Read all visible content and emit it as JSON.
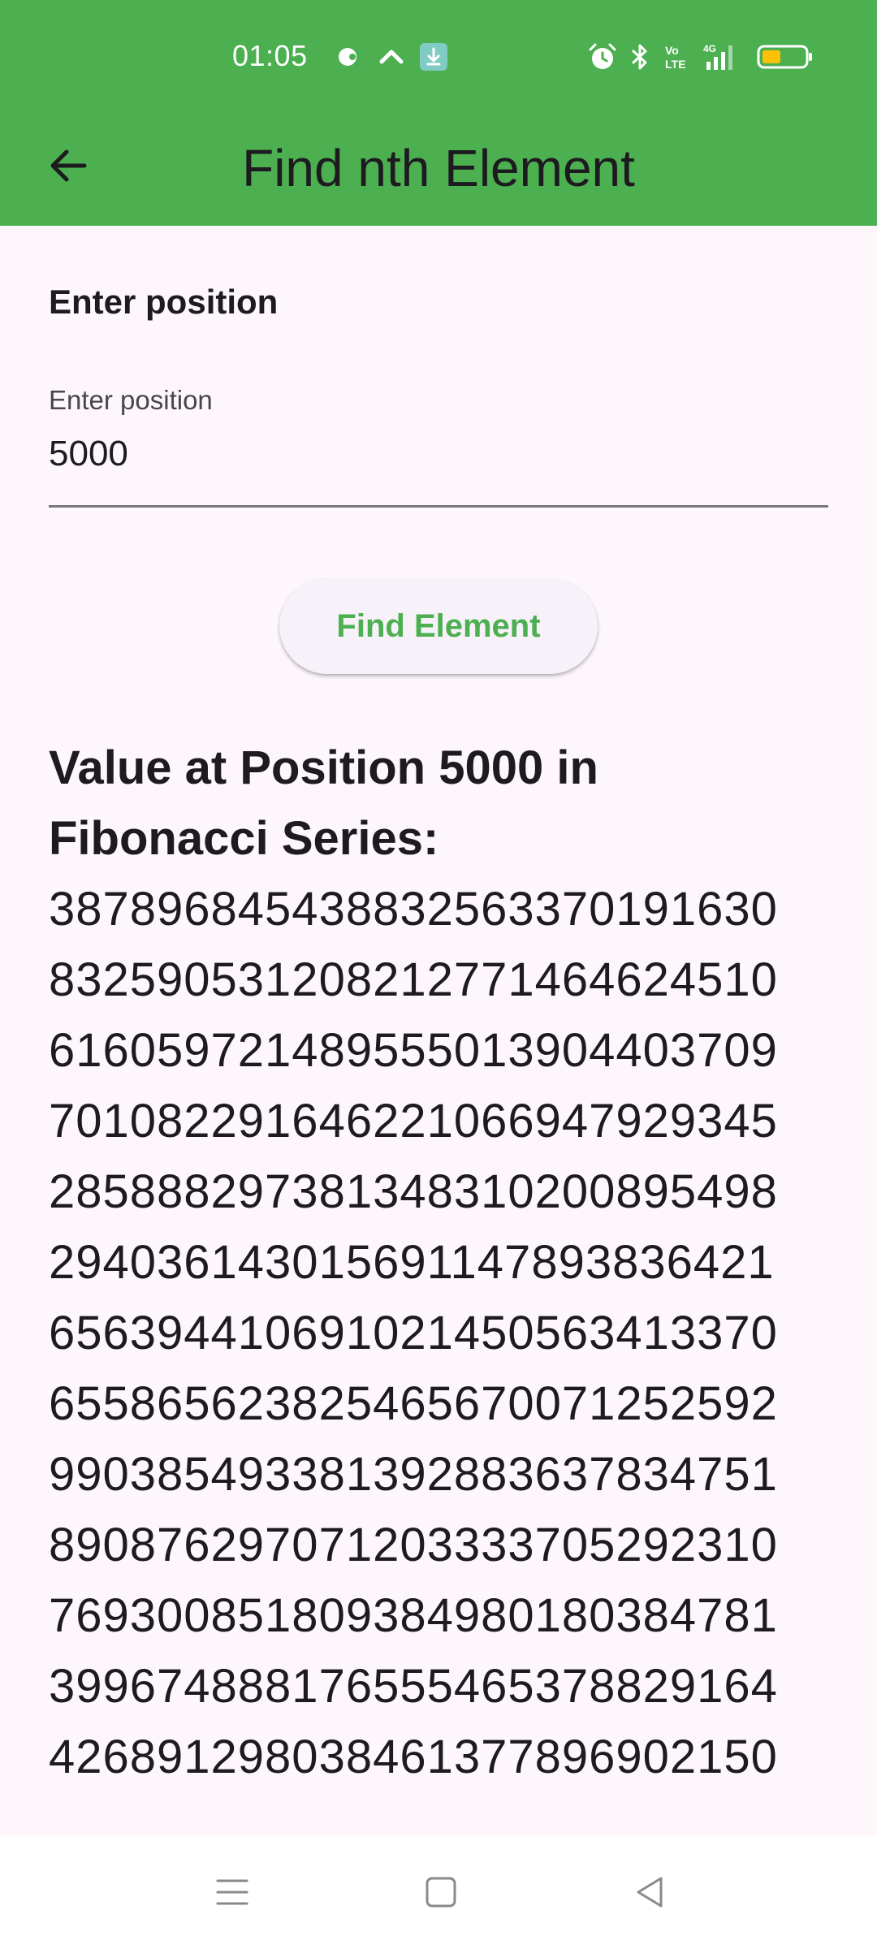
{
  "status_bar": {
    "time": "01:05",
    "icons": [
      "notification-icon",
      "chevron-up-icon",
      "download-icon",
      "alarm-icon",
      "bluetooth-icon",
      "volte-icon",
      "4g-signal-icon",
      "battery-icon"
    ]
  },
  "appbar": {
    "title": "Find nth Element",
    "back_icon": "arrow-back-icon",
    "background": "#4caf50"
  },
  "form": {
    "section_label": "Enter position",
    "input": {
      "label": "Enter position",
      "value": "5000"
    },
    "button_label": "Find Element"
  },
  "result": {
    "heading": "Value at Position 5000 in Fibonacci Series:",
    "digit_lines": [
      "387896845438832563370191630",
      "832590531208212771464624510",
      "616059721489555013904403709",
      "701082291646221066947929345",
      "285888297381348310200895498",
      "294036143015691147893836421",
      "656394410691021450563413370",
      "655865623825465670071252592",
      "990385493381392883637834751",
      "890876297071203333705292310",
      "769300851809384980180384781",
      "399674888176555465378829164",
      "426891298038461377896902150"
    ]
  },
  "nav_bar": {
    "icons": [
      "menu-icon",
      "home-icon",
      "back-icon"
    ]
  },
  "colors": {
    "accent": "#4caf50",
    "background": "#fdf7fb",
    "text": "#1d1b20"
  }
}
